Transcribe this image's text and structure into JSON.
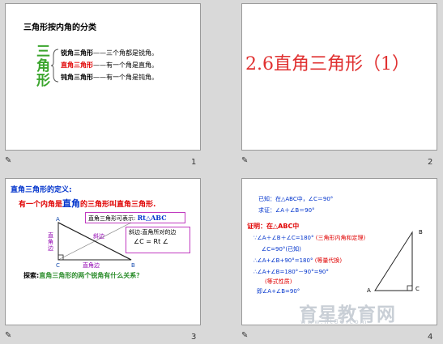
{
  "slide1": {
    "title": "三角形按内角的分类",
    "big_chars": [
      "三",
      "角",
      "形"
    ],
    "items": [
      {
        "name": "锐角三角形",
        "rest": "——三个角都是锐角。"
      },
      {
        "name": "直角三角形",
        "rest": "——有一个角是直角。"
      },
      {
        "name": "钝角三角形",
        "rest": "——有一个角是钝角。"
      }
    ],
    "number": "1"
  },
  "slide2": {
    "title": "2.6直角三角形（1）",
    "number": "2"
  },
  "slide3": {
    "heading": "直角三角形的定义:",
    "def_a": "有一个内角是",
    "def_b": "直角",
    "def_c": "的三角形叫直角三角形.",
    "box1_label": "直角三角形可表示:",
    "box1_value": "Rt△ABC",
    "box2_label": "斜边:直角所对的边",
    "box2_value": "∠C = Rt ∠",
    "label_hyp": "斜边",
    "label_leg1": "直角边",
    "label_leg2": "直角边",
    "pt_a": "A",
    "pt_b": "B",
    "pt_c": "C",
    "question_prefix": "探索:",
    "question": "直角三角形的两个锐角有什么关系？",
    "number": "3"
  },
  "slide4": {
    "given1": "已知：在△ABC中，∠C＝90°",
    "given2": "求证：∠A＋∠B＝90°",
    "proof_title": "证明：在△ABC中",
    "line1": "∵∠A＋∠B＋∠C=180°",
    "line1_note": "(三角形内角和定理)",
    "line2": "∠C=90°(已知)",
    "line3": "∴∠A+∠B+90°=180°",
    "line3_note": "(等量代换)",
    "line4": "∴∠A+∠B=180°－90°=90°",
    "line5": "(等式性质)",
    "line6": "即∠A+∠B=90°",
    "pt_a": "A",
    "pt_b": "B",
    "pt_c": "C",
    "watermark_text": "育星教育网",
    "watermark_url": "www.ht88.com",
    "number": "4"
  },
  "note_icon": "note-icon"
}
